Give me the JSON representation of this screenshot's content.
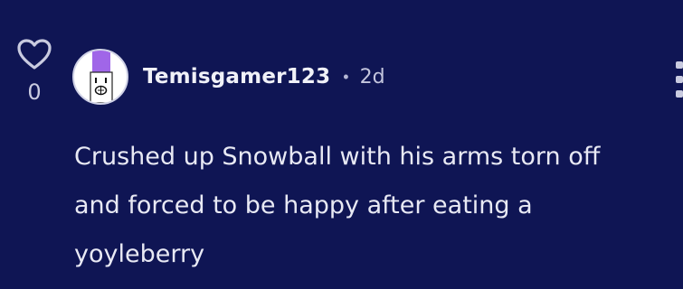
{
  "comment": {
    "like_count": "0",
    "username": "Temisgamer123",
    "separator": "•",
    "time": "2d",
    "text": "Crushed up Snowball with his arms torn off and forced to be happy after eating a yoyleberry"
  },
  "icons": {
    "like": "heart-outline-icon",
    "menu": "more-vertical-icon",
    "avatar": "user-avatar-drawing"
  },
  "colors": {
    "background": "#0f1554",
    "text": "#e8e9f4",
    "muted": "#c4c6de",
    "avatar_accent": "#a066e8"
  }
}
